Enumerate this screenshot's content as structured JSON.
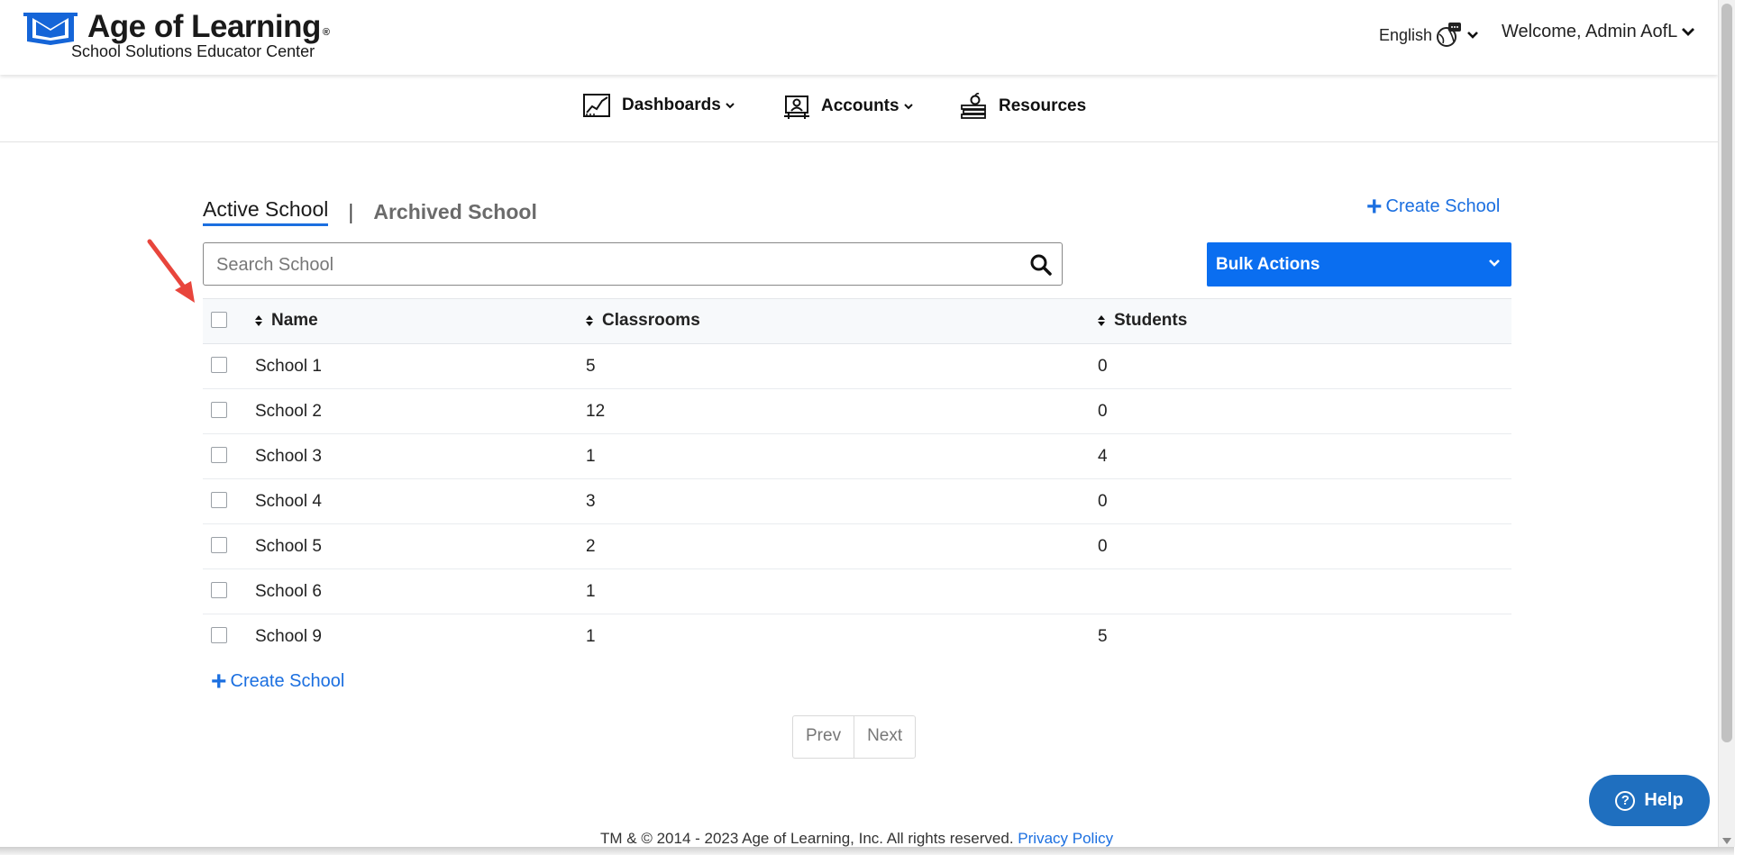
{
  "header": {
    "brand_title": "Age of Learning",
    "brand_reg": "®",
    "brand_subtitle": "School Solutions Educator Center",
    "language": "English",
    "welcome": "Welcome, Admin AofL"
  },
  "nav": {
    "items": [
      {
        "label": "Dashboards",
        "icon": "chart-icon",
        "has_dropdown": true
      },
      {
        "label": "Accounts",
        "icon": "accounts-icon",
        "has_dropdown": true
      },
      {
        "label": "Resources",
        "icon": "resources-icon",
        "has_dropdown": false
      }
    ]
  },
  "tabs": {
    "active": "Active School",
    "separator": "|",
    "inactive": "Archived School"
  },
  "actions": {
    "create_school": "Create School",
    "bulk_actions": "Bulk Actions"
  },
  "search": {
    "placeholder": "Search School",
    "value": ""
  },
  "table": {
    "columns": [
      "Name",
      "Classrooms",
      "Students"
    ],
    "rows": [
      {
        "name": "School 1",
        "classrooms": "5",
        "students": "0"
      },
      {
        "name": "School 2",
        "classrooms": "12",
        "students": "0"
      },
      {
        "name": "School 3",
        "classrooms": "1",
        "students": "4"
      },
      {
        "name": "School 4",
        "classrooms": "3",
        "students": "0"
      },
      {
        "name": "School 5",
        "classrooms": "2",
        "students": "0"
      },
      {
        "name": "School 6",
        "classrooms": "1",
        "students": ""
      },
      {
        "name": "School 9",
        "classrooms": "1",
        "students": "5"
      }
    ]
  },
  "pagination": {
    "prev": "Prev",
    "next": "Next"
  },
  "footer": {
    "copyright": "TM & © 2014 - 2023 Age of Learning, Inc. All rights reserved.",
    "privacy": "Privacy Policy"
  },
  "help": {
    "label": "Help"
  },
  "colors": {
    "accent": "#0a6ef0",
    "link": "#1b6fe0",
    "help_button": "#1f6fbf",
    "annotation_arrow": "#e8453c"
  }
}
